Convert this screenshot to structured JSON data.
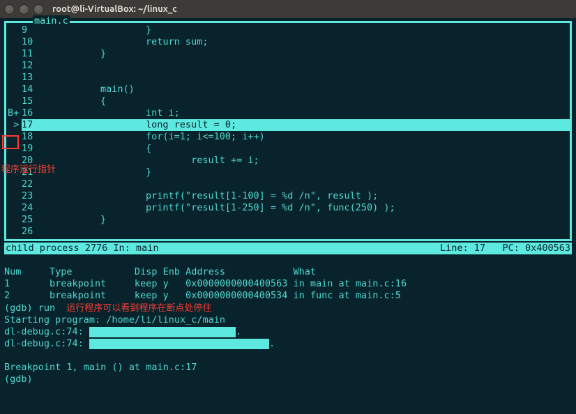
{
  "window": {
    "title": "root@li-VirtualBox: ~/linux_c"
  },
  "source": {
    "label": "main.c",
    "gutter_marker": "B+",
    "lines": [
      {
        "n": "9",
        "g": "",
        "code": "                }"
      },
      {
        "n": "10",
        "g": "",
        "code": "                return sum;"
      },
      {
        "n": "11",
        "g": "",
        "code": "        }"
      },
      {
        "n": "12",
        "g": "",
        "code": ""
      },
      {
        "n": "13",
        "g": "",
        "code": ""
      },
      {
        "n": "14",
        "g": "",
        "code": "        main()"
      },
      {
        "n": "15",
        "g": "",
        "code": "        {"
      },
      {
        "n": "16",
        "g": "B+",
        "code": "                int i;"
      },
      {
        "n": "17",
        "g": " >",
        "code": "                long result = 0;         ",
        "hl": true
      },
      {
        "n": "18",
        "g": "",
        "code": "                for(i=1; i<=100; i++)"
      },
      {
        "n": "19",
        "g": "",
        "code": "                {"
      },
      {
        "n": "20",
        "g": "",
        "code": "                        result += i;"
      },
      {
        "n": "21",
        "g": "",
        "code": "                }"
      },
      {
        "n": "22",
        "g": "",
        "code": ""
      },
      {
        "n": "23",
        "g": "",
        "code": "                printf(\"result[1-100] = %d /n\", result );"
      },
      {
        "n": "24",
        "g": "",
        "code": "                printf(\"result[1-250] = %d /n\", func(250) );"
      },
      {
        "n": "25",
        "g": "",
        "code": "        }"
      },
      {
        "n": "26",
        "g": "",
        "code": ""
      }
    ]
  },
  "status": {
    "left": "child process 2776 In: main",
    "line_label": "Line:",
    "line_value": "17",
    "pc_label": "PC:",
    "pc_value": "0x400563"
  },
  "breakpoints": {
    "header": {
      "num": "Num",
      "type": "Type",
      "disp": "Disp",
      "enb": "Enb",
      "address": "Address",
      "what": "What"
    },
    "rows": [
      {
        "num": "1",
        "type": "breakpoint",
        "disp": "keep",
        "enb": "y",
        "address": "0x0000000000400563",
        "what": "in main at main.c:16"
      },
      {
        "num": "2",
        "type": "breakpoint",
        "disp": "keep",
        "enb": "y",
        "address": "0x0000000000400534",
        "what": "in func at main.c:5"
      }
    ]
  },
  "gdb": {
    "run_cmd": "(gdb) run",
    "starting": "Starting program: /home/li/linux_c/main",
    "dl1": "dl-debug.c:74:",
    "dl1_tail": ".",
    "dl2": "dl-debug.c:74:",
    "dl2_tail": ".",
    "bp_hit": "Breakpoint 1, main () at main.c:17",
    "prompt": "(gdb) "
  },
  "annotations": {
    "pointer_label": "程序运行指针",
    "run_note": "运行程序可以看到程序在断点处停住"
  }
}
